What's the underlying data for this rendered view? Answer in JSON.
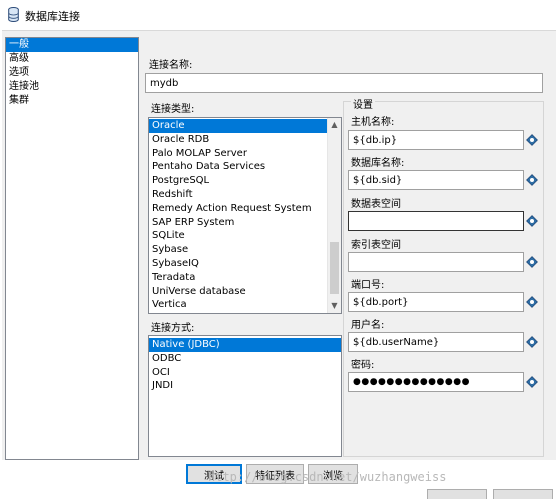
{
  "window": {
    "title": "数据库连接",
    "icon": "database-icon"
  },
  "nav": {
    "items": [
      {
        "label": "一般",
        "selected": true
      },
      {
        "label": "高级"
      },
      {
        "label": "选项"
      },
      {
        "label": "连接池"
      },
      {
        "label": "集群"
      }
    ]
  },
  "connection_name": {
    "label": "连接名称:",
    "value": "mydb"
  },
  "connection_type": {
    "label": "连接类型:",
    "items": [
      "Oracle",
      "Oracle RDB",
      "Palo MOLAP Server",
      "Pentaho Data Services",
      "PostgreSQL",
      "Redshift",
      "Remedy Action Request System",
      "SAP ERP System",
      "SQLite",
      "Sybase",
      "SybaseIQ",
      "Teradata",
      "UniVerse database",
      "Vertica"
    ],
    "selected": "Oracle"
  },
  "access_method": {
    "label": "连接方式:",
    "items": [
      "Native (JDBC)",
      "ODBC",
      "OCI",
      "JNDI"
    ],
    "selected": "Native (JDBC)"
  },
  "settings": {
    "title": "设置",
    "host": {
      "label": "主机名称:",
      "value": "${db.ip}"
    },
    "database": {
      "label": "数据库名称:",
      "value": "${db.sid}"
    },
    "data_tablespace": {
      "label": "数据表空间",
      "value": ""
    },
    "index_tablespace": {
      "label": "索引表空间",
      "value": ""
    },
    "port": {
      "label": "端口号:",
      "value": "${db.port}"
    },
    "username": {
      "label": "用户名:",
      "value": "${db.userName}"
    },
    "password": {
      "label": "密码:",
      "value": "●●●●●●●●●●●●●●"
    }
  },
  "buttons": {
    "test": "测试",
    "features": "特征列表",
    "explore": "浏览"
  },
  "watermark": "http://blog.csdn.net/wuzhangweiss",
  "colors": {
    "selection": "#0078d7",
    "variable_icon": "#2e6da4"
  }
}
